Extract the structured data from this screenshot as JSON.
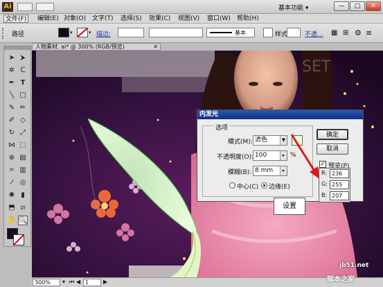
{
  "app": {
    "logo": "Ai",
    "workspace": "基本功能",
    "min": "—",
    "max": "□",
    "close": "✕"
  },
  "menu": [
    "文件(F)",
    "编辑(E)",
    "对象(O)",
    "文字(T)",
    "选择(S)",
    "效果(C)",
    "视图(V)",
    "窗口(W)",
    "帮助(H)"
  ],
  "control": {
    "path_label": "路径",
    "stroke_label": "描边:",
    "style_preset": "基本",
    "style_label": "样式:",
    "opacity_label": "不透..."
  },
  "document": {
    "tab_title": "人物素材. ai* @ 300% (RGB/预览)",
    "zoom": "300%",
    "page": "1"
  },
  "canvas": {
    "watermark": "SET"
  },
  "dialog": {
    "title": "内发光",
    "group_label": "选项",
    "mode_label": "模式(M):",
    "mode_value": "滤色",
    "opacity_label": "不透明度(O):",
    "opacity_value": "100",
    "opacity_unit": "%",
    "blur_label": "模糊(B):",
    "blur_value": "8 mm",
    "center_label": "中心(C)",
    "edge_label": "边缘(E)",
    "ok": "确定",
    "cancel": "取消",
    "preview_label": "预览(P)",
    "glow_color": "#ecffcf"
  },
  "rgb": {
    "r_label": "R:",
    "r": "236",
    "g_label": "G:",
    "g": "255",
    "b_label": "B:",
    "b": "207"
  },
  "annotation": {
    "callout": "设置"
  },
  "watermark": {
    "line1": "jb51.net",
    "line2": "脚本之家"
  },
  "colors": {
    "leaf": "#dcf7cd",
    "leaf_outline": "#3bcf3b",
    "arrow": "#e01818",
    "dialog_title": "#1b3f98"
  }
}
